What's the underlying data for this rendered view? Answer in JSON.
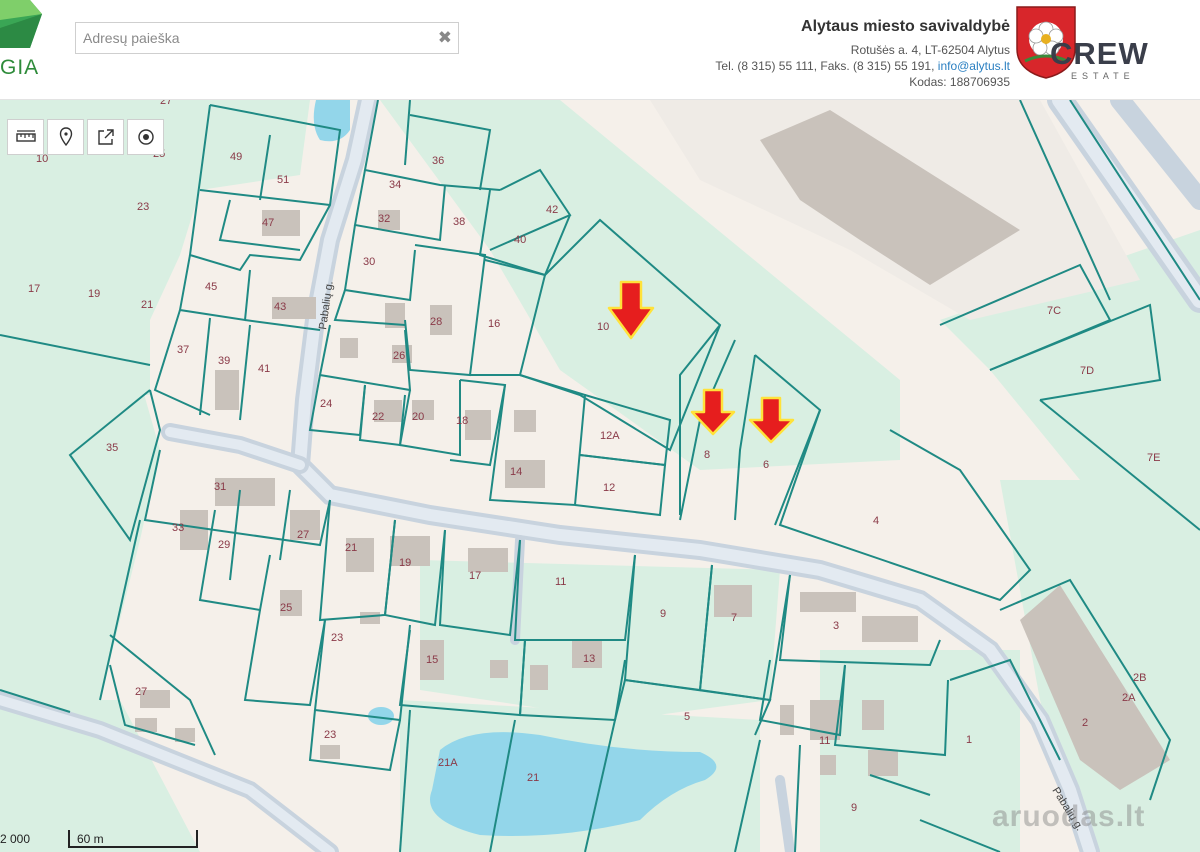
{
  "header": {
    "logo_text": "GIA",
    "search_placeholder": "Adresų paieška",
    "municipality": {
      "name": "Alytaus miesto savivaldybė",
      "address": "Rotušės a. 4, LT-62504 Alytus",
      "phone": "Tel. (8 315) 55 111, Faks. (8 315) 55 191,",
      "email": "info@alytus.lt",
      "code": "Kodas: 188706935"
    },
    "brand": {
      "name": "CREW",
      "sub": "ESTATE"
    }
  },
  "toolbar": {
    "icons": [
      "ruler-icon",
      "location-pin-icon",
      "share-icon",
      "target-icon"
    ]
  },
  "map": {
    "street_label": "Pabalių g.",
    "parcels": [
      "49",
      "51",
      "47",
      "36",
      "34",
      "32",
      "38",
      "42",
      "40",
      "30",
      "45",
      "43",
      "28",
      "16",
      "10",
      "26",
      "37",
      "39",
      "41",
      "24",
      "22",
      "20",
      "18",
      "12A",
      "14",
      "12",
      "8",
      "6",
      "35",
      "31",
      "33",
      "29",
      "27",
      "21",
      "19",
      "17",
      "11",
      "9",
      "7",
      "3",
      "25",
      "23",
      "15",
      "13",
      "5",
      "27",
      "23",
      "21A",
      "21",
      "11",
      "9",
      "1",
      "2",
      "2A",
      "2B",
      "4",
      "7C",
      "7D",
      "7E",
      "17",
      "19",
      "21",
      "23",
      "10",
      "25",
      "27"
    ],
    "colors": {
      "parcel_line": "#1f8a84",
      "green_area": "#d9efe2",
      "road": "#d4dde6",
      "water": "#93d6ea",
      "building": "#c9c2bb",
      "marker": "#e61e1e"
    }
  },
  "scale": {
    "ratio": "2 000",
    "length": "60 m"
  },
  "watermark": "aruodas.lt"
}
